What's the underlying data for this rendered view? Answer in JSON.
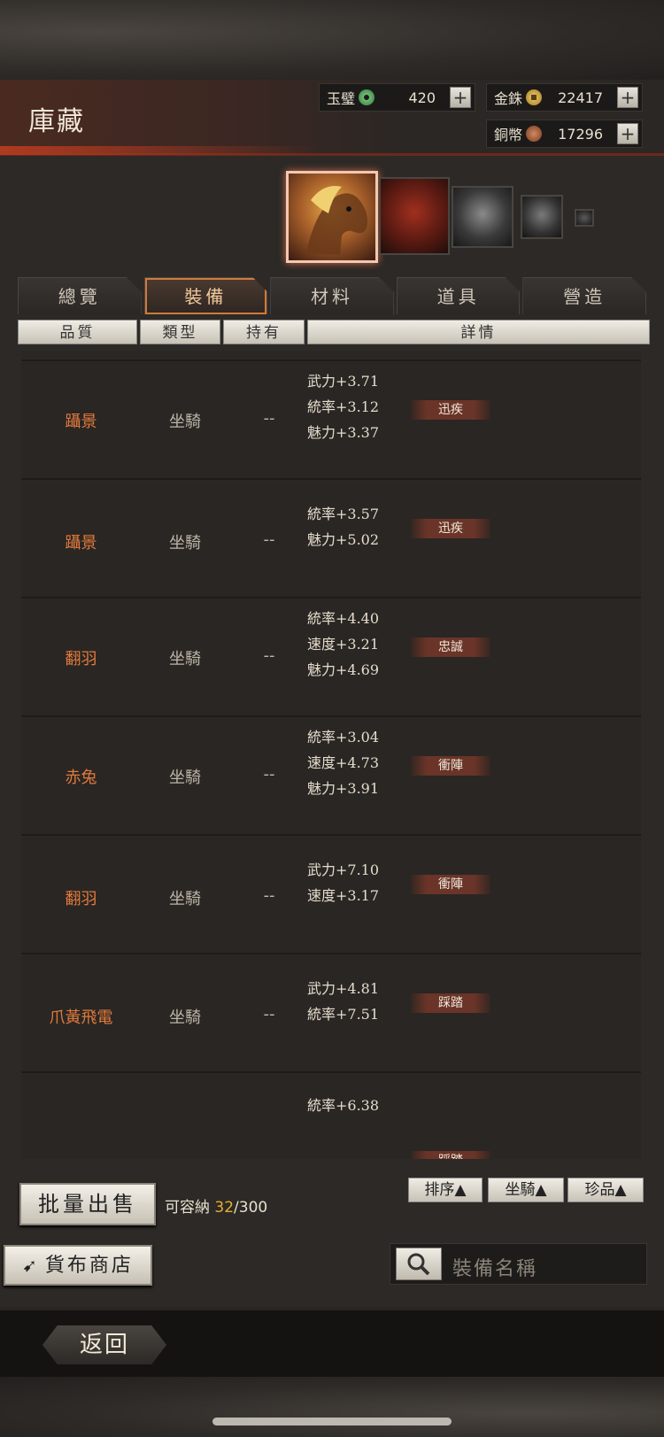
{
  "title": "庫藏",
  "currencies": [
    {
      "name": "玉璧",
      "value": "420",
      "color": "#3c9a4a"
    },
    {
      "name": "金銖",
      "value": "22417",
      "color": "#c9a032"
    },
    {
      "name": "銅幣",
      "value": "17296",
      "color": "#a05a3a"
    }
  ],
  "plus_label": "+",
  "tabs": [
    "總覽",
    "裝備",
    "材料",
    "道具",
    "營造"
  ],
  "active_tab": "裝備",
  "columns": [
    "品質",
    "類型",
    "持有",
    "詳情"
  ],
  "rows": [
    {
      "name": "躡景",
      "type": "坐騎",
      "owner": "--",
      "stats": [
        "武力+3.71",
        "統率+3.12",
        "魅力+3.37"
      ],
      "tag": "迅疾"
    },
    {
      "name": "躡景",
      "type": "坐騎",
      "owner": "--",
      "stats": [
        "統率+3.57",
        "魅力+5.02"
      ],
      "tag": "迅疾"
    },
    {
      "name": "翻羽",
      "type": "坐騎",
      "owner": "--",
      "stats": [
        "統率+4.40",
        "速度+3.21",
        "魅力+4.69"
      ],
      "tag": "忠誠"
    },
    {
      "name": "赤兔",
      "type": "坐騎",
      "owner": "--",
      "stats": [
        "統率+3.04",
        "速度+4.73",
        "魅力+3.91"
      ],
      "tag": "衝陣"
    },
    {
      "name": "翻羽",
      "type": "坐騎",
      "owner": "--",
      "stats": [
        "武力+7.10",
        "速度+3.17"
      ],
      "tag": "衝陣"
    },
    {
      "name": "爪黃飛電",
      "type": "坐騎",
      "owner": "--",
      "stats": [
        "武力+4.81",
        "統率+7.51"
      ],
      "tag": "踩踏"
    },
    {
      "name": "",
      "type": "",
      "owner": "",
      "stats": [
        "統率+6.38"
      ],
      "tag": "踩踏"
    }
  ],
  "bulk_sell": "批量出售",
  "capacity_label": "可容納",
  "capacity_used": "32",
  "capacity_total": "/300",
  "sort_buttons": [
    "排序▲",
    "坐騎▲",
    "珍品▲"
  ],
  "shop_button": "貨布商店",
  "search_placeholder": "裝備名稱",
  "back_button": "返回"
}
